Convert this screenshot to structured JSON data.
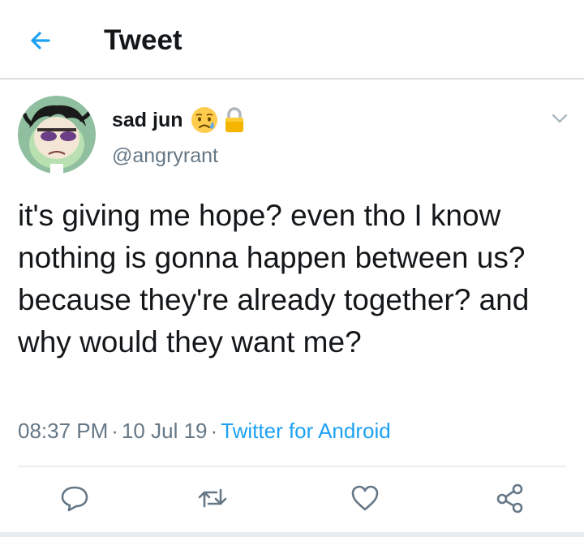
{
  "header": {
    "title": "Tweet",
    "back_icon": "arrow-left-icon"
  },
  "tweet": {
    "author": {
      "name": "sad jun",
      "emoji": "sad-sweat-face-emoji",
      "protected_icon": "lock-icon",
      "handle": "@angryrant"
    },
    "text": "it's giving me hope? even tho I know nothing is gonna happen between us? because they're already together? and why would they want me?",
    "time": "08:37 PM",
    "separator": "·",
    "date": "10 Jul 19",
    "source": "Twitter for Android"
  },
  "actions": [
    {
      "icon": "reply-icon"
    },
    {
      "icon": "retweet-icon"
    },
    {
      "icon": "like-icon"
    },
    {
      "icon": "share-icon"
    }
  ],
  "colors": {
    "accent": "#1da1f2",
    "text": "#14171a",
    "secondary": "#657786",
    "divider": "#e6ecf0"
  }
}
